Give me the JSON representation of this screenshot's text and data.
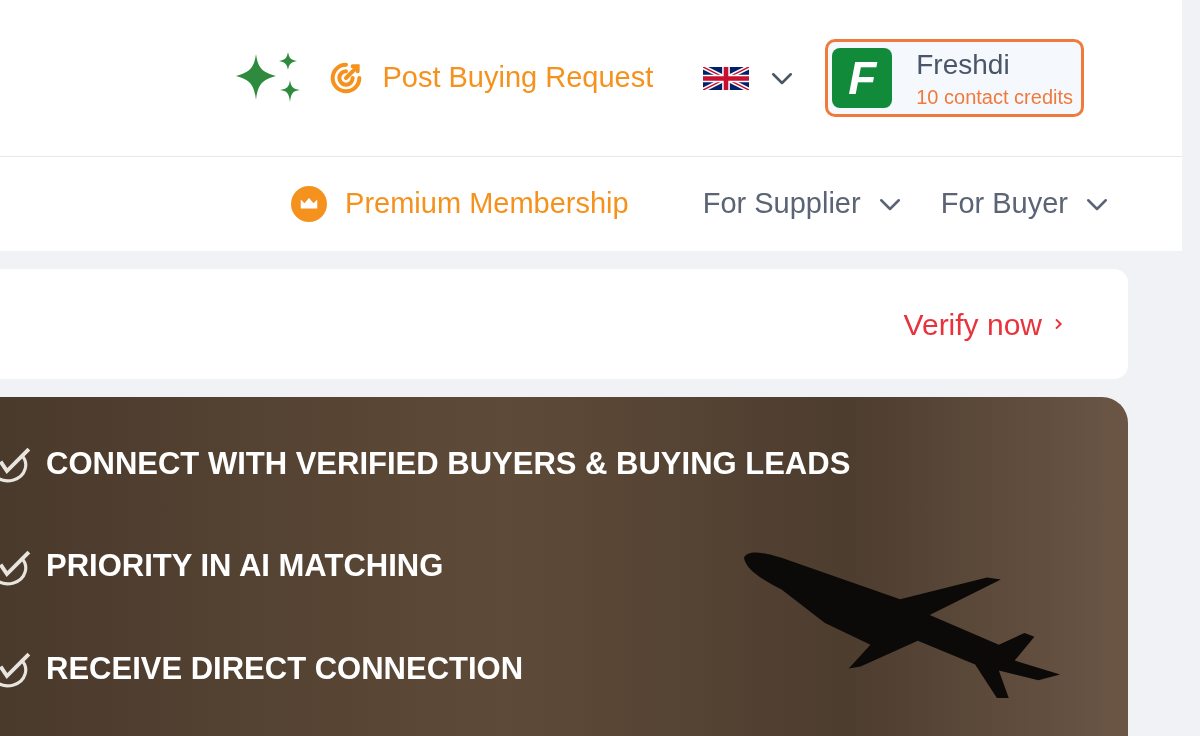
{
  "header": {
    "post_request": "Post Buying Request",
    "account": {
      "logo_letter": "F",
      "name": "Freshdi",
      "credits": "10 contact credits"
    }
  },
  "nav": {
    "premium": "Premium Membership",
    "menus": [
      {
        "label": "For Supplier"
      },
      {
        "label": "For Buyer"
      }
    ]
  },
  "verify_card": {
    "link": "Verify now"
  },
  "banner": {
    "benefits": [
      "CONNECT WITH VERIFIED BUYERS & BUYING LEADS",
      "PRIORITY IN AI MATCHING",
      "RECEIVE DIRECT CONNECTION"
    ]
  }
}
